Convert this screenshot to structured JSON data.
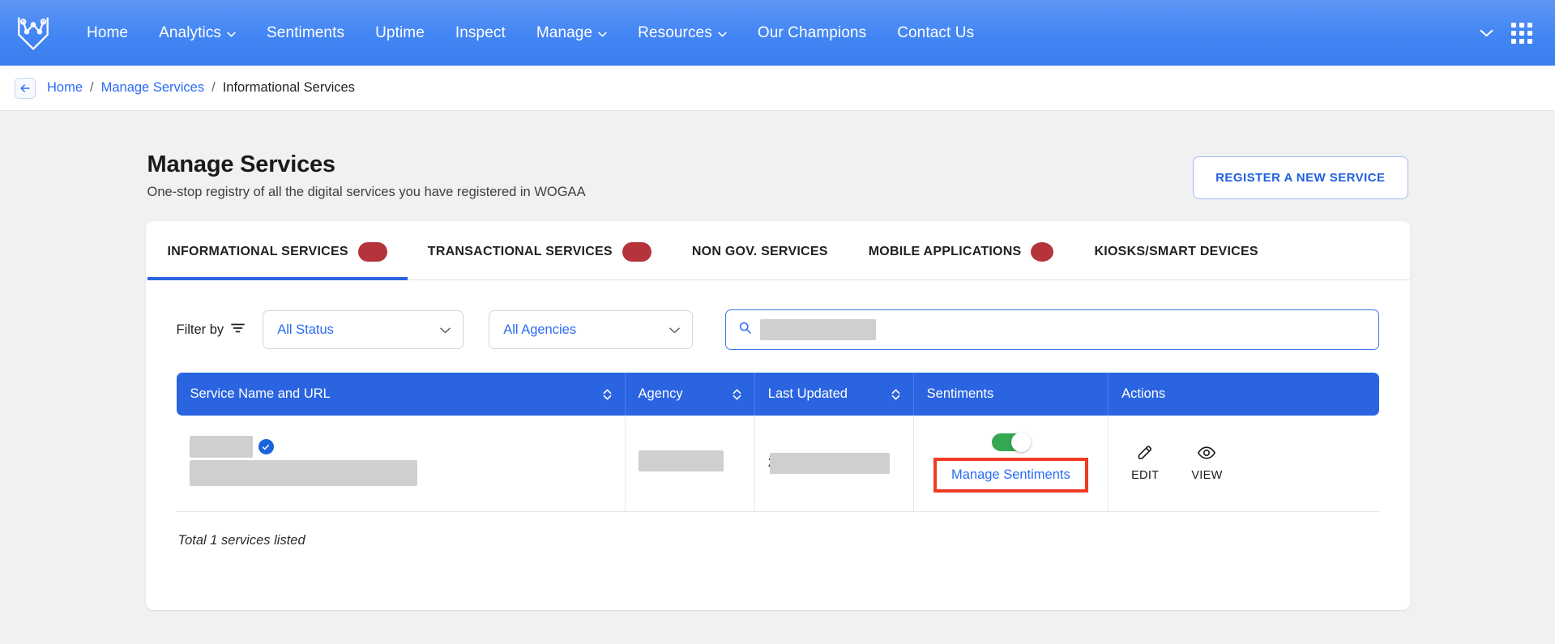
{
  "navbar": {
    "logo_name": "wogaa-logo",
    "links": [
      {
        "label": "Home",
        "has_caret": false
      },
      {
        "label": "Analytics",
        "has_caret": true
      },
      {
        "label": "Sentiments",
        "has_caret": false
      },
      {
        "label": "Uptime",
        "has_caret": false
      },
      {
        "label": "Inspect",
        "has_caret": false
      },
      {
        "label": "Manage",
        "has_caret": true
      },
      {
        "label": "Resources",
        "has_caret": true
      },
      {
        "label": "Our Champions",
        "has_caret": false
      },
      {
        "label": "Contact Us",
        "has_caret": false
      }
    ],
    "accent_color": "#4285f4"
  },
  "breadcrumb": {
    "back_label": "",
    "home": "Home",
    "sep": "/",
    "parent": "Manage Services",
    "current": "Informational Services"
  },
  "header": {
    "title": "Manage Services",
    "subtitle": "One-stop registry of all the digital services you have registered in WOGAA",
    "register_button": "REGISTER A NEW SERVICE"
  },
  "tabs": [
    {
      "label": "INFORMATIONAL SERVICES",
      "badge": true,
      "badge_shape": "pill",
      "active": true
    },
    {
      "label": "TRANSACTIONAL SERVICES",
      "badge": true,
      "badge_shape": "pill",
      "active": false
    },
    {
      "label": "NON GOV. SERVICES",
      "badge": false,
      "badge_shape": "",
      "active": false
    },
    {
      "label": "MOBILE APPLICATIONS",
      "badge": true,
      "badge_shape": "round",
      "active": false
    },
    {
      "label": "KIOSKS/SMART DEVICES",
      "badge": false,
      "badge_shape": "",
      "active": false
    }
  ],
  "filters": {
    "label": "Filter by",
    "status_select": {
      "value": "All Status"
    },
    "agency_select": {
      "value": "All Agencies"
    },
    "search": {
      "value": "",
      "placeholder": "",
      "redacted": true
    }
  },
  "table": {
    "columns": [
      {
        "label": "Service Name and URL",
        "sortable": true
      },
      {
        "label": "Agency",
        "sortable": true
      },
      {
        "label": "Last Updated",
        "sortable": true
      },
      {
        "label": "Sentiments",
        "sortable": false
      },
      {
        "label": "Actions",
        "sortable": false
      }
    ],
    "rows": [
      {
        "service_name": "",
        "service_name_redacted": true,
        "verified": true,
        "url": "",
        "url_redacted": true,
        "agency": "",
        "agency_redacted": true,
        "last_updated": "2",
        "last_updated_redacted": true,
        "sentiments_toggle": "on",
        "manage_sentiments_label": "Manage Sentiments",
        "manage_sentiments_highlighted": true,
        "actions": [
          {
            "label": "EDIT",
            "icon": "pencil-icon"
          },
          {
            "label": "VIEW",
            "icon": "eye-icon"
          }
        ]
      }
    ],
    "header_bg": "#2b64e0"
  },
  "footer": {
    "total_text": "Total 1 services listed"
  },
  "colors": {
    "primary_blue": "#2b64e0",
    "link_blue": "#2b6cf6",
    "badge_red": "#b5333a",
    "toggle_green": "#34a853",
    "highlight_red": "#ef3b23"
  }
}
